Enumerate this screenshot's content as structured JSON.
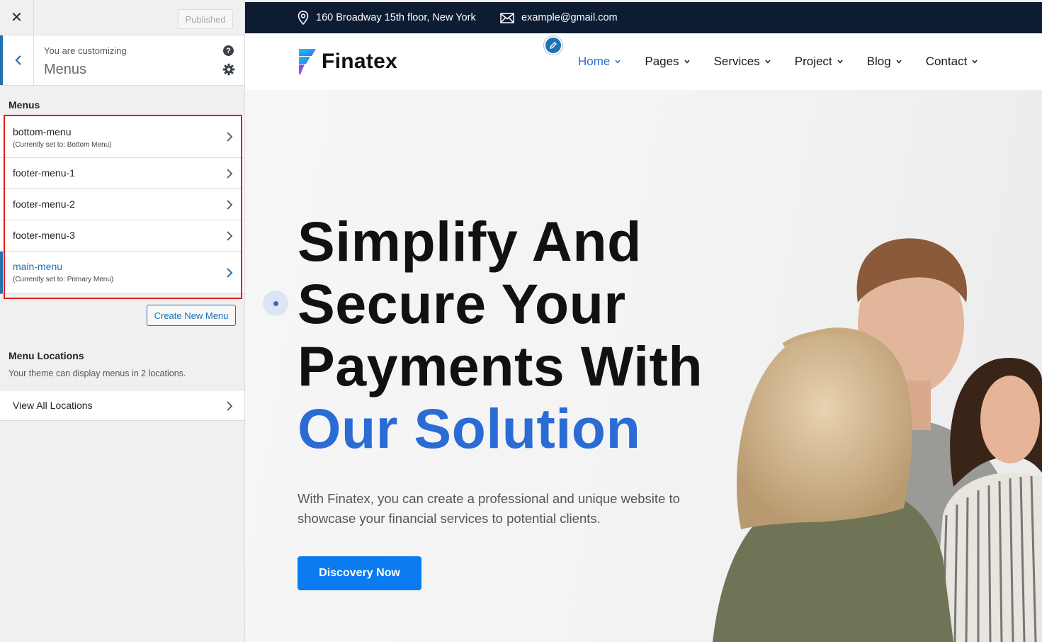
{
  "sidebar": {
    "close_label": "✕",
    "published_label": "Published",
    "customizing_label": "You are customizing",
    "panel_title": "Menus",
    "help_label": "?",
    "menus_heading": "Menus",
    "menus": [
      {
        "name": "bottom-menu",
        "sub": "(Currently set to: Bottom Menu)"
      },
      {
        "name": "footer-menu-1",
        "sub": ""
      },
      {
        "name": "footer-menu-2",
        "sub": ""
      },
      {
        "name": "footer-menu-3",
        "sub": ""
      },
      {
        "name": "main-menu",
        "sub": "(Currently set to: Primary Menu)"
      }
    ],
    "create_menu_label": "Create New Menu",
    "locations_heading": "Menu Locations",
    "locations_desc": "Your theme can display menus in 2 locations.",
    "view_locations_label": "View All Locations"
  },
  "site": {
    "address": "160 Broadway 15th floor, New York",
    "email": "example@gmail.com",
    "logo_text": "Finatex",
    "nav": [
      {
        "label": "Home",
        "active": true
      },
      {
        "label": "Pages"
      },
      {
        "label": "Services"
      },
      {
        "label": "Project"
      },
      {
        "label": "Blog"
      },
      {
        "label": "Contact"
      }
    ],
    "hero": {
      "line1": "Simplify And",
      "line2": "Secure Your",
      "line3": "Payments With",
      "line4": "Our Solution",
      "desc": "With Finatex, you can create a professional and unique website to showcase your financial services to potential clients.",
      "cta": "Discovery Now"
    }
  },
  "colors": {
    "wp_accent": "#2271b1",
    "highlight": "#e31c1c",
    "topbar_bg": "#0d1b33",
    "site_accent": "#2b6cd4",
    "cta_bg": "#0b7cf0"
  },
  "icons": {
    "close": "close-icon",
    "back": "chevron-left-icon",
    "help": "help-icon",
    "settings": "gear-icon",
    "row": "chevron-right-icon",
    "location": "map-pin-icon",
    "email": "envelope-icon",
    "edit": "pencil-icon",
    "dropdown": "chevron-down-icon"
  }
}
